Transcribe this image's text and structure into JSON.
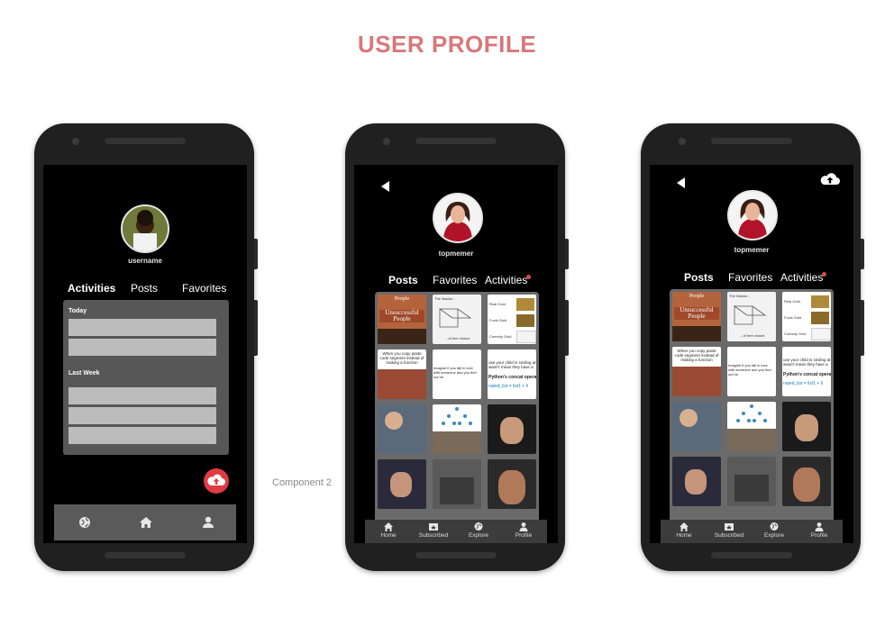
{
  "page": {
    "title": "USER PROFILE",
    "component_label": "Component 2"
  },
  "phone1": {
    "username": "username",
    "tabs": [
      "Activities",
      "Posts",
      "Favorites"
    ],
    "sections": [
      {
        "label": "Today",
        "rows": 2
      },
      {
        "label": "Last Week",
        "rows": 3
      }
    ],
    "nav_icons": [
      "globe-icon",
      "home-icon",
      "person-icon"
    ],
    "upload_icon": "cloud-upload-icon"
  },
  "phone2": {
    "username": "topmemer",
    "tabs": [
      "Posts",
      "Favorites",
      "Activities"
    ],
    "nav": [
      "Home",
      "Subscribed",
      "Explore",
      "Profile"
    ]
  },
  "phone3": {
    "username": "topmemer",
    "tabs": [
      "Posts",
      "Favorites",
      "Activities"
    ],
    "nav": [
      "Home",
      "Subscribed",
      "Explore",
      "Profile"
    ]
  },
  "memes": {
    "unsuccessful_top": "People",
    "unsuccessful": "Unsuccessful People",
    "illusion": "The illusion...",
    "choice": "...of free choice.",
    "real_gold": "Real Gold",
    "fools_gold": "Fools Gold",
    "comedy_gold": "Comedy Gold",
    "copy_paste": "When you copy paste code segment instead of making a function",
    "love": "Imagine if you fall in love with someone and you find out he",
    "python": "Python's concat opera",
    "concat": "nated_list = list1 + li",
    "smiling": "use your child is smiling at wasn't mean they have a"
  },
  "colors": {
    "accent": "#e23a43",
    "title": "#d9777a",
    "dot": "#e24a4a"
  }
}
